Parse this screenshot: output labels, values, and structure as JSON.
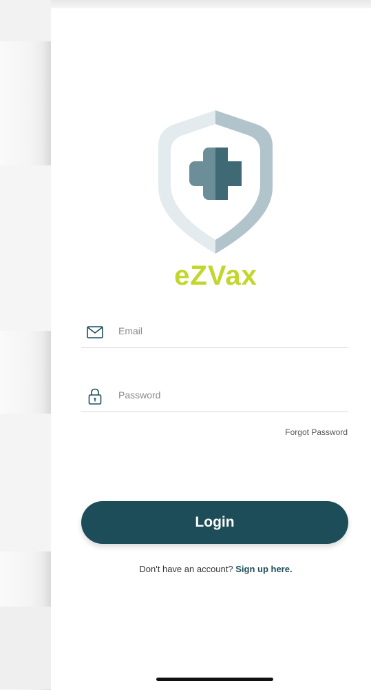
{
  "app": {
    "brand_name": "eZVax",
    "brand_color": "#c2d62b",
    "primary_color": "#1d4d58"
  },
  "logo": {
    "icon": "shield-plus-icon"
  },
  "form": {
    "email": {
      "icon": "mail-icon",
      "placeholder": "Email",
      "value": ""
    },
    "password": {
      "icon": "lock-icon",
      "placeholder": "Password",
      "value": ""
    },
    "forgot_password_label": "Forgot Password",
    "login_label": "Login"
  },
  "signup": {
    "prompt": "Don't have an account?",
    "link_label": "Sign up here."
  }
}
